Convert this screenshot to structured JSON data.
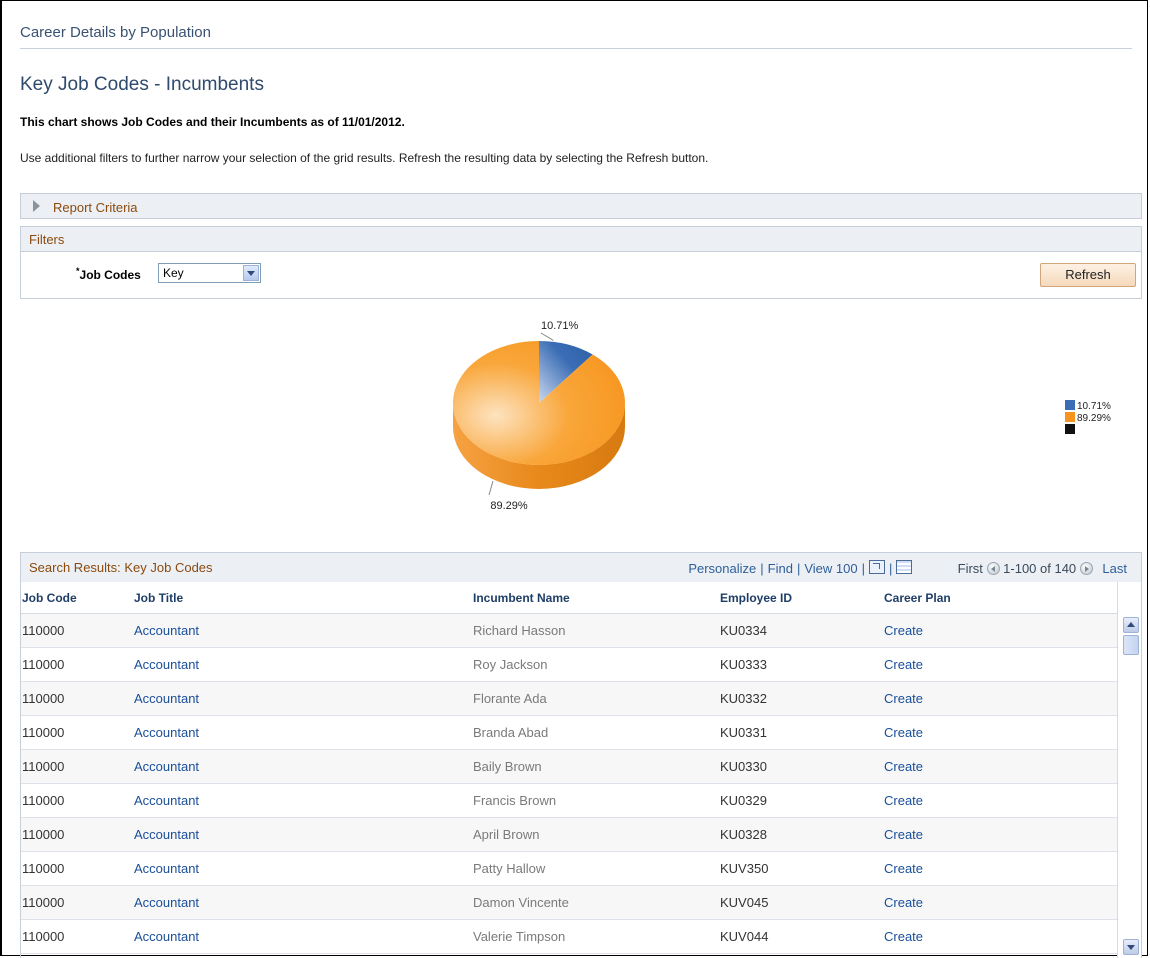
{
  "page": {
    "header": "Career Details by Population",
    "title": "Key Job Codes - Incumbents",
    "chart_description": "This chart shows Job Codes and their Incumbents as of 11/01/2012.",
    "instructions": "Use additional filters to further narrow your selection of the grid results. Refresh the resulting data by selecting the Refresh button."
  },
  "report_criteria": {
    "label": "Report Criteria"
  },
  "filters": {
    "title": "Filters",
    "required_mark": "*",
    "job_codes_label": "Job Codes",
    "job_codes_value": "Key",
    "refresh_label": "Refresh"
  },
  "chart_data": {
    "type": "pie",
    "slices": [
      {
        "label": "10.71%",
        "value": 10.71,
        "color": "#3a6db5"
      },
      {
        "label": "89.29%",
        "value": 89.29,
        "color": "#f7941d"
      }
    ],
    "legend": [
      {
        "label": "10.71%",
        "color": "#3a6db5"
      },
      {
        "label": "89.29%",
        "color": "#f7941d"
      },
      {
        "label": "",
        "color": "#111111"
      }
    ],
    "legend_position": "right"
  },
  "grid": {
    "title": "Search Results: Key Job Codes",
    "tools": {
      "personalize": "Personalize",
      "find": "Find",
      "view": "View 100",
      "first": "First",
      "range": "1-100 of 140",
      "last": "Last"
    },
    "columns": [
      "Job Code",
      "Job Title",
      "Incumbent Name",
      "Employee ID",
      "Career Plan"
    ],
    "rows": [
      [
        "110000",
        "Accountant",
        "Richard Hasson",
        "KU0334",
        "Create"
      ],
      [
        "110000",
        "Accountant",
        "Roy Jackson",
        "KU0333",
        "Create"
      ],
      [
        "110000",
        "Accountant",
        "Florante Ada",
        "KU0332",
        "Create"
      ],
      [
        "110000",
        "Accountant",
        "Branda Abad",
        "KU0331",
        "Create"
      ],
      [
        "110000",
        "Accountant",
        "Baily Brown",
        "KU0330",
        "Create"
      ],
      [
        "110000",
        "Accountant",
        "Francis Brown",
        "KU0329",
        "Create"
      ],
      [
        "110000",
        "Accountant",
        "April Brown",
        "KU0328",
        "Create"
      ],
      [
        "110000",
        "Accountant",
        "Patty Hallow",
        "KUV350",
        "Create"
      ],
      [
        "110000",
        "Accountant",
        "Damon Vincente",
        "KUV045",
        "Create"
      ],
      [
        "110000",
        "Accountant",
        "Valerie Timpson",
        "KUV044",
        "Create"
      ]
    ]
  }
}
